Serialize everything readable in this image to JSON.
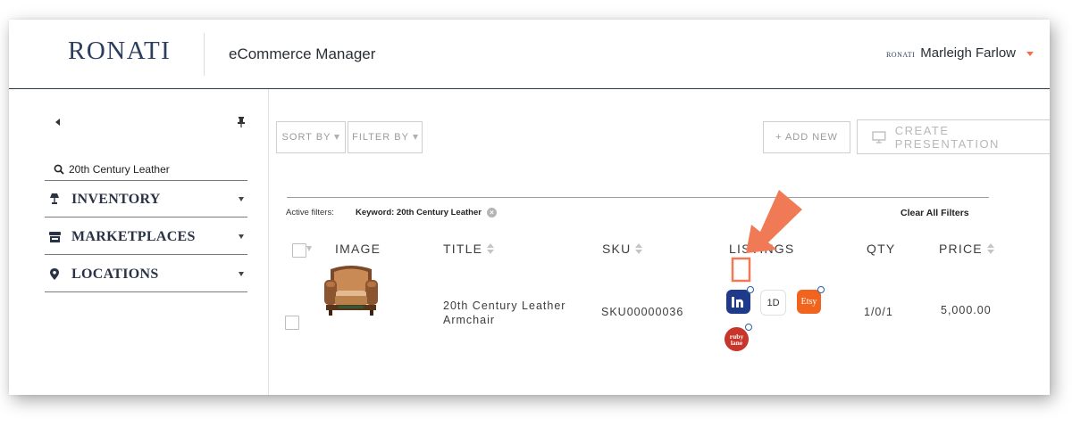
{
  "header": {
    "logo": "RONATI",
    "app_name": "eCommerce Manager",
    "user_logo": "RONATI",
    "user_name": "Marleigh Farlow"
  },
  "sidebar": {
    "search_value": "20th Century Leather",
    "items": [
      {
        "label": "INVENTORY",
        "icon": "lamp-icon"
      },
      {
        "label": "MARKETPLACES",
        "icon": "storefront-icon"
      },
      {
        "label": "LOCATIONS",
        "icon": "map-pin-icon"
      }
    ]
  },
  "toolbar": {
    "sort_label": "SORT BY",
    "filter_label": "FILTER BY",
    "add_new_label": "+ ADD NEW",
    "create_label": "CREATE PRESENTATION"
  },
  "filters": {
    "label": "Active filters:",
    "chips": [
      "Keyword: 20th Century Leather"
    ],
    "clear_label": "Clear All Filters"
  },
  "table": {
    "columns": [
      "IMAGE",
      "TITLE",
      "SKU",
      "LISTINGS",
      "QTY",
      "PRICE"
    ],
    "rows": [
      {
        "title_line1": "20th Century Leather",
        "title_line2": "Armchair",
        "sku": "SKU00000036",
        "listings": [
          {
            "icon": "1stdibs-logo-icon",
            "text": "1st"
          },
          {
            "icon": "1d-badge-icon",
            "text": "1D"
          },
          {
            "icon": "etsy-logo-icon",
            "text": "Etsy"
          },
          {
            "icon": "ruby-lane-logo-icon",
            "text": "ruby lane"
          }
        ],
        "qty": "1/0/1",
        "price": "5,000.00"
      }
    ]
  },
  "colors": {
    "accent": "#f07a55",
    "navy": "#2c3e5c",
    "etsy": "#f1641e",
    "ruby_lane": "#c8352a",
    "firstdibs": "#1f3a8a"
  }
}
